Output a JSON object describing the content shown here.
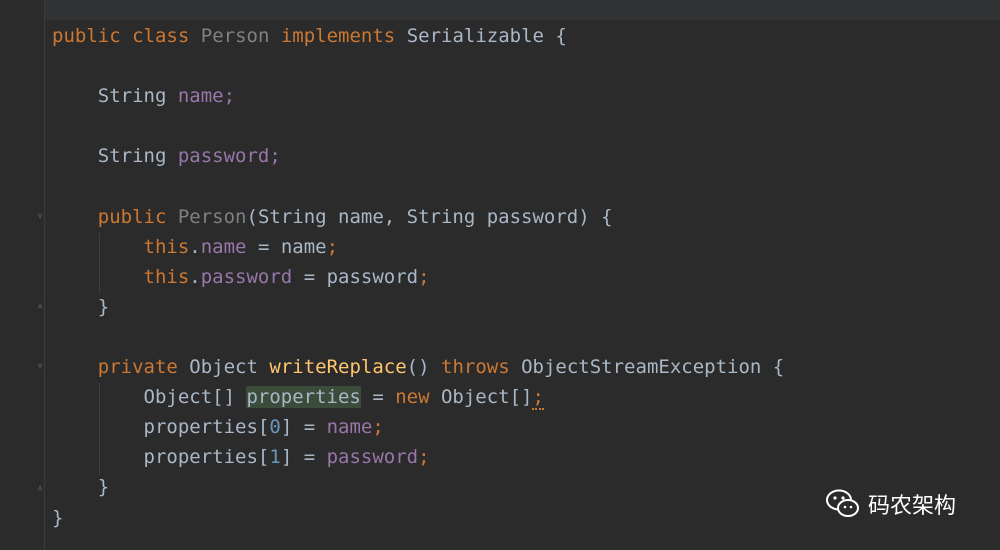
{
  "watermark": {
    "text": "码农架构",
    "icon": "wechat-icon"
  },
  "code": {
    "lines": [
      [
        "public",
        "class",
        "Person",
        "implements",
        "Serializable {"
      ],
      [
        "String",
        "name;"
      ],
      [
        "String",
        "password;"
      ],
      [
        "public",
        "Person",
        "(String name, String password) {"
      ],
      [
        "this",
        ".",
        "name",
        " = name",
        ";"
      ],
      [
        "this",
        ".",
        "password",
        " = password",
        ";"
      ],
      [
        "}"
      ],
      [
        "private",
        "Object",
        "writeReplace",
        "()",
        "throws",
        "ObjectStreamException {"
      ],
      [
        "Object[]",
        "properties",
        " = ",
        "new",
        " Object[]",
        ";"
      ],
      [
        "properties[",
        "0",
        "] = ",
        "name",
        ";"
      ],
      [
        "properties[",
        "1",
        "] = ",
        "password",
        ";"
      ],
      [
        "}"
      ],
      [
        "}"
      ]
    ]
  }
}
